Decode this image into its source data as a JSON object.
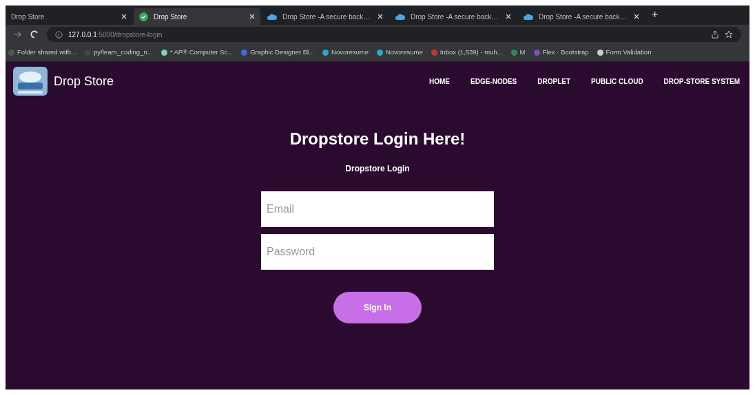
{
  "browser": {
    "tabs": [
      {
        "title": "Drop Store",
        "kind": "plain",
        "selected": false
      },
      {
        "title": "Drop Store",
        "kind": "check",
        "selected": true
      },
      {
        "title": "Drop Store -A secure back…",
        "kind": "cloud",
        "selected": false
      },
      {
        "title": "Drop Store -A secure back…",
        "kind": "cloud",
        "selected": false
      },
      {
        "title": "Drop Store -A secure back…",
        "kind": "cloud",
        "selected": false
      }
    ],
    "new_tab": "+",
    "url": {
      "host": "127.0.0.1",
      "path": ":5000/dropstore-login"
    },
    "bookmarks": [
      {
        "label": "Folder shared with...",
        "color": "#555555"
      },
      {
        "label": "py/learn_coding_n...",
        "color": "#444444"
      },
      {
        "label": "* AP® Computer Sc...",
        "color": "#7fd3b0"
      },
      {
        "label": "Graphic Designer Bl...",
        "color": "#3b6fd8"
      },
      {
        "label": "Novoresume",
        "color": "#2aa7c9"
      },
      {
        "label": "Novoresume",
        "color": "#2aa7c9"
      },
      {
        "label": "Inbox (1,539) - muh...",
        "color": "#c0392b"
      },
      {
        "label": "M",
        "color": "#2e8b57"
      },
      {
        "label": "Flex · Bootstrap",
        "color": "#7952b3"
      },
      {
        "label": "Form Validation",
        "color": "#cccccc"
      }
    ]
  },
  "navbar": {
    "brand": "Drop Store",
    "links": [
      "HOME",
      "EDGE-NODES",
      "DROPLET",
      "PUBLIC CLOUD",
      "DROP-STORE SYSTEM"
    ]
  },
  "login": {
    "title": "Dropstore Login Here!",
    "subtitle": "Dropstore Login",
    "fields": [
      {
        "placeholder": "Email"
      },
      {
        "placeholder": "Password"
      }
    ],
    "button": "Sign In"
  }
}
